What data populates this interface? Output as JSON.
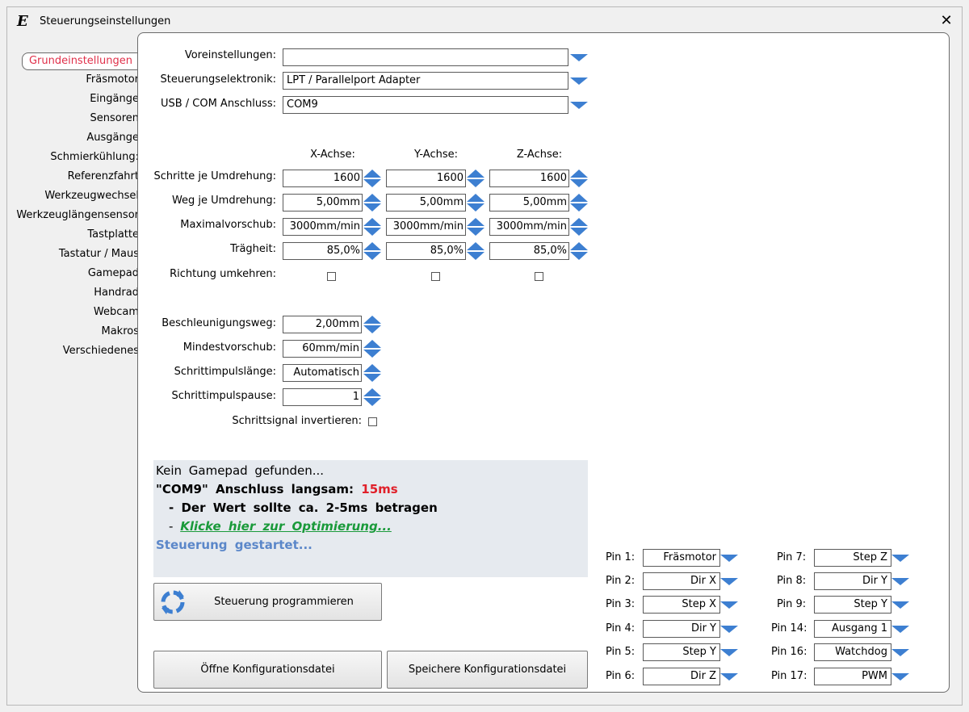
{
  "window": {
    "title": "Steuerungseinstellungen",
    "icon_text": "E"
  },
  "nav": {
    "items": [
      {
        "label": "Grundeinstellungen",
        "active": true
      },
      {
        "label": "Fräsmotor"
      },
      {
        "label": "Eingänge"
      },
      {
        "label": "Sensoren"
      },
      {
        "label": "Ausgänge"
      },
      {
        "label": "Schmierkühlung:"
      },
      {
        "label": "Referenzfahrt"
      },
      {
        "label": "Werkzeugwechsel"
      },
      {
        "label": "Werkzeuglängensensor"
      },
      {
        "label": "Tastplatte"
      },
      {
        "label": "Tastatur / Maus"
      },
      {
        "label": "Gamepad"
      },
      {
        "label": "Handrad"
      },
      {
        "label": "Webcam"
      },
      {
        "label": "Makros"
      },
      {
        "label": "Verschiedenes"
      }
    ]
  },
  "settings": {
    "presets_label": "Voreinstellungen:",
    "presets_value": "",
    "electronics_label": "Steuerungselektronik:",
    "electronics_value": "LPT / Parallelport Adapter",
    "port_label": "USB / COM Anschluss:",
    "port_value": "COM9"
  },
  "axes": {
    "headers": [
      "X-Achse:",
      "Y-Achse:",
      "Z-Achse:"
    ],
    "rows": [
      {
        "label": "Schritte je Umdrehung:",
        "values": [
          "1600",
          "1600",
          "1600"
        ]
      },
      {
        "label": "Weg je Umdrehung:",
        "values": [
          "5,00mm",
          "5,00mm",
          "5,00mm"
        ]
      },
      {
        "label": "Maximalvorschub:",
        "values": [
          "3000mm/min",
          "3000mm/min",
          "3000mm/min"
        ]
      },
      {
        "label": "Trägheit:",
        "values": [
          "85,0%",
          "85,0%",
          "85,0%"
        ]
      }
    ],
    "reverse_label": "Richtung umkehren:"
  },
  "motion": {
    "accel_label": "Beschleunigungsweg:",
    "accel_value": "2,00mm",
    "minfeed_label": "Mindestvorschub:",
    "minfeed_value": "60mm/min",
    "pulselen_label": "Schrittimpulslänge:",
    "pulselen_value": "Automatisch",
    "pulsepause_label": "Schrittimpulspause:",
    "pulsepause_value": "1",
    "invert_label": "Schrittsignal invertieren:"
  },
  "log": {
    "line1": "Kein Gamepad gefunden...",
    "line2_prefix": "\"COM9\" Anschluss langsam:",
    "line2_value": "15ms",
    "line3": "- Der Wert sollte ca. 2-5ms betragen",
    "line4_dash": "-",
    "line4_link": "Klicke hier zur Optimierung...",
    "line5": "Steuerung gestartet...",
    "colors": {
      "value": "#e0202a",
      "link": "#1a9a3a",
      "status": "#5b87c9"
    }
  },
  "buttons": {
    "program": "Steuerung programmieren",
    "open_config": "Öffne Konfigurationsdatei",
    "save_config": "Speichere Konfigurationsdatei"
  },
  "pins": {
    "left": [
      {
        "label": "Pin 1:",
        "value": "Fräsmotor"
      },
      {
        "label": "Pin 2:",
        "value": "Dir X"
      },
      {
        "label": "Pin 3:",
        "value": "Step X"
      },
      {
        "label": "Pin 4:",
        "value": "Dir Y"
      },
      {
        "label": "Pin 5:",
        "value": "Step Y"
      },
      {
        "label": "Pin 6:",
        "value": "Dir Z"
      }
    ],
    "right": [
      {
        "label": "Pin 7:",
        "value": "Step Z"
      },
      {
        "label": "Pin 8:",
        "value": "Dir Y"
      },
      {
        "label": "Pin 9:",
        "value": "Step Y"
      },
      {
        "label": "Pin 14:",
        "value": "Ausgang 1"
      },
      {
        "label": "Pin 16:",
        "value": "Watchdog"
      },
      {
        "label": "Pin 17:",
        "value": "PWM"
      }
    ]
  },
  "accent_color": "#3d7fd1",
  "active_tab_color": "#e0304a"
}
